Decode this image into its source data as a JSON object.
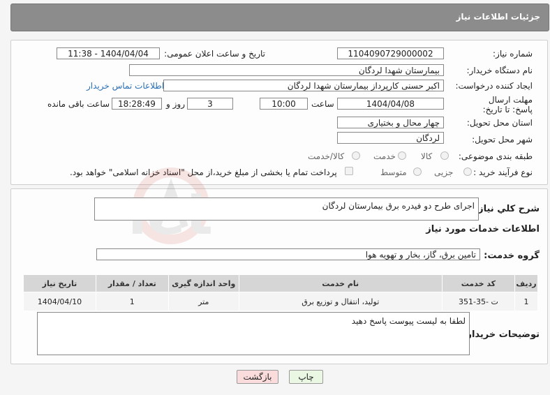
{
  "header": {
    "title": "جزئیات اطلاعات نیاز"
  },
  "labels": {
    "need_number": "شماره نیاز:",
    "announce_datetime": "تاریخ و ساعت اعلان عمومی:",
    "buyer_org": "نام دستگاه خریدار:",
    "requester": "ایجاد کننده درخواست:",
    "deadline": "مهلت ارسال پاسخ: تا تاریخ:",
    "time_word": "ساعت",
    "day_and": "روز و",
    "remaining": "ساعت باقی مانده",
    "province": "استان محل تحویل:",
    "city": "شهر محل تحویل:",
    "subject_class": "طبقه بندی موضوعی:",
    "purchase_type": "نوع فرآیند خرید :",
    "general_desc": "شرح کلي نياز:",
    "services_info": "اطلاعات خدمات مورد نیاز",
    "service_group": "گروه خدمت:",
    "buyer_notes": "توضیحات خریدار:"
  },
  "values": {
    "need_number": "1104090729000002",
    "announce_datetime": "1404/04/04 - 11:38",
    "buyer_org": "بیمارستان شهدا لردگان",
    "requester": "اکبر حسنی کارپرداز بیمارستان شهدا لردگان",
    "contact_link": "اطلاعات تماس خریدار",
    "deadline_date": "1404/04/08",
    "deadline_time": "10:00",
    "days": "3",
    "remaining_time": "18:28:49",
    "province": "چهار محال و بختیاری",
    "city": "لردگان",
    "general_desc": "اجرای طرح دو فیدره برق بیمارستان لردگان",
    "service_group": "تامین برق، گاز، بخار و تهویه هوا",
    "buyer_notes": "لطفا به لیست پیوست پاسخ دهید"
  },
  "subject_options": [
    "کالا",
    "خدمت",
    "کالا/خدمت"
  ],
  "purchase_options": [
    "جزیی",
    "متوسط"
  ],
  "payment_note": "پرداخت تمام یا بخشی از مبلغ خرید،از محل \"اسناد خزانه اسلامی\" خواهد بود.",
  "table": {
    "headers": [
      "ردیف",
      "کد خدمت",
      "نام خدمت",
      "واحد اندازه گیری",
      "تعداد / مقدار",
      "تاریخ نیاز"
    ],
    "rows": [
      [
        "1",
        "ت -35-351",
        "تولید، انتقال و توزیع برق",
        "متر",
        "1",
        "1404/04/10"
      ]
    ]
  },
  "buttons": {
    "print": "چاپ",
    "back": "بازگشت"
  },
  "colors": {
    "header_bg": "#8c8c8c",
    "link": "#2a6fb5",
    "back_button_bg": "#fbdcdc",
    "print_button_bg": "#e9f7e3"
  }
}
